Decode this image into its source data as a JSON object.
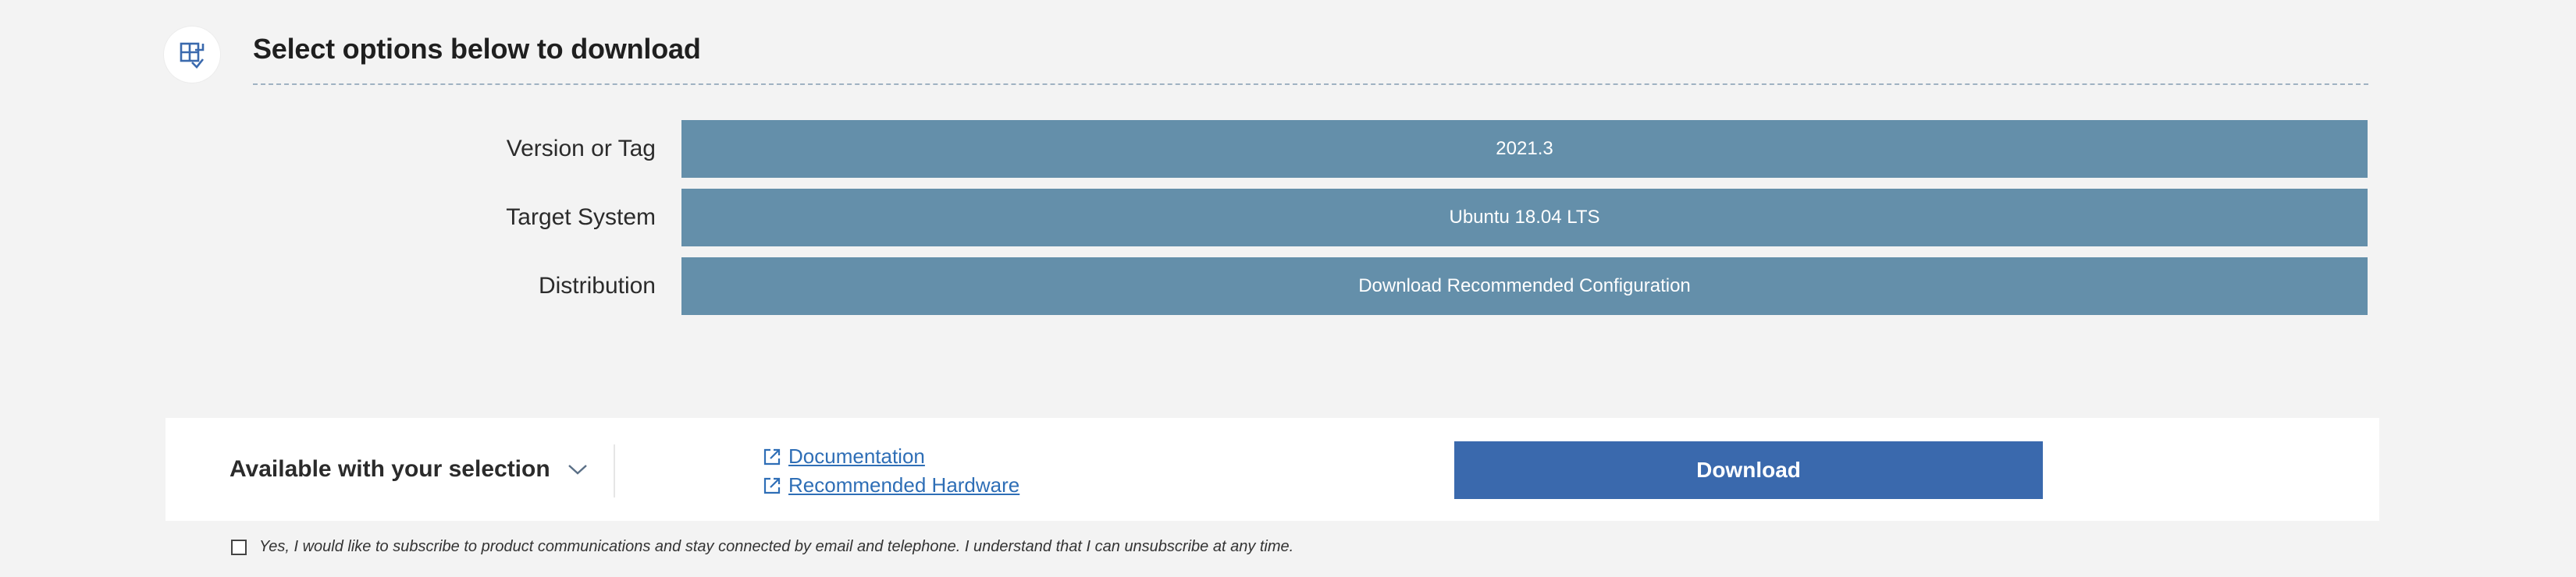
{
  "header": {
    "icon": "download-options-icon",
    "title": "Select options below to download"
  },
  "options": {
    "version": {
      "label": "Version or Tag",
      "value": "2021.3"
    },
    "target": {
      "label": "Target System",
      "value": "Ubuntu 18.04 LTS"
    },
    "distribution": {
      "label": "Distribution",
      "value": "Download Recommended Configuration"
    }
  },
  "action_bar": {
    "available_label": "Available with your selection",
    "available_icon": "chevron-down-icon",
    "links": [
      {
        "label": "Documentation",
        "icon": "external-link-icon"
      },
      {
        "label": "Recommended Hardware",
        "icon": "external-link-icon"
      }
    ],
    "download_label": "Download"
  },
  "consent": {
    "checked": false,
    "text": "Yes, I would like to subscribe to product communications and stay connected by email and telephone. I understand that I can unsubscribe at any time."
  },
  "colors": {
    "background": "#f3f3f3",
    "option_fill": "#648faa",
    "download_button": "#3a69ad",
    "link": "#2e6eb6"
  }
}
